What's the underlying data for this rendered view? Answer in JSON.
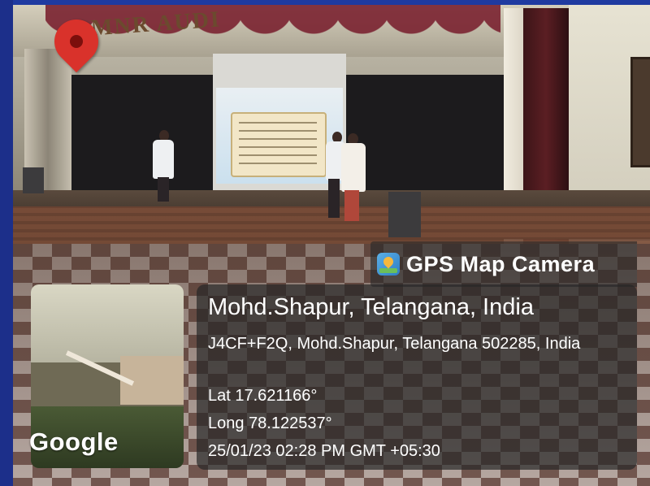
{
  "scene": {
    "venue_sign": "MNR AUDI"
  },
  "brand": {
    "icon": "gps-map-camera-icon",
    "label": "GPS Map Camera"
  },
  "map": {
    "pin_icon": "map-pin-icon",
    "provider": "Google"
  },
  "location": {
    "title": "Mohd.Shapur, Telangana, India",
    "address": "J4CF+F2Q, Mohd.Shapur, Telangana 502285, India",
    "lat": "Lat 17.621166°",
    "long": "Long 78.122537°",
    "timestamp": "25/01/23 02:28 PM GMT +05:30"
  },
  "colors": {
    "frame_border": "#1b2e86",
    "overlay": "#262626",
    "pin": "#d9322b"
  }
}
